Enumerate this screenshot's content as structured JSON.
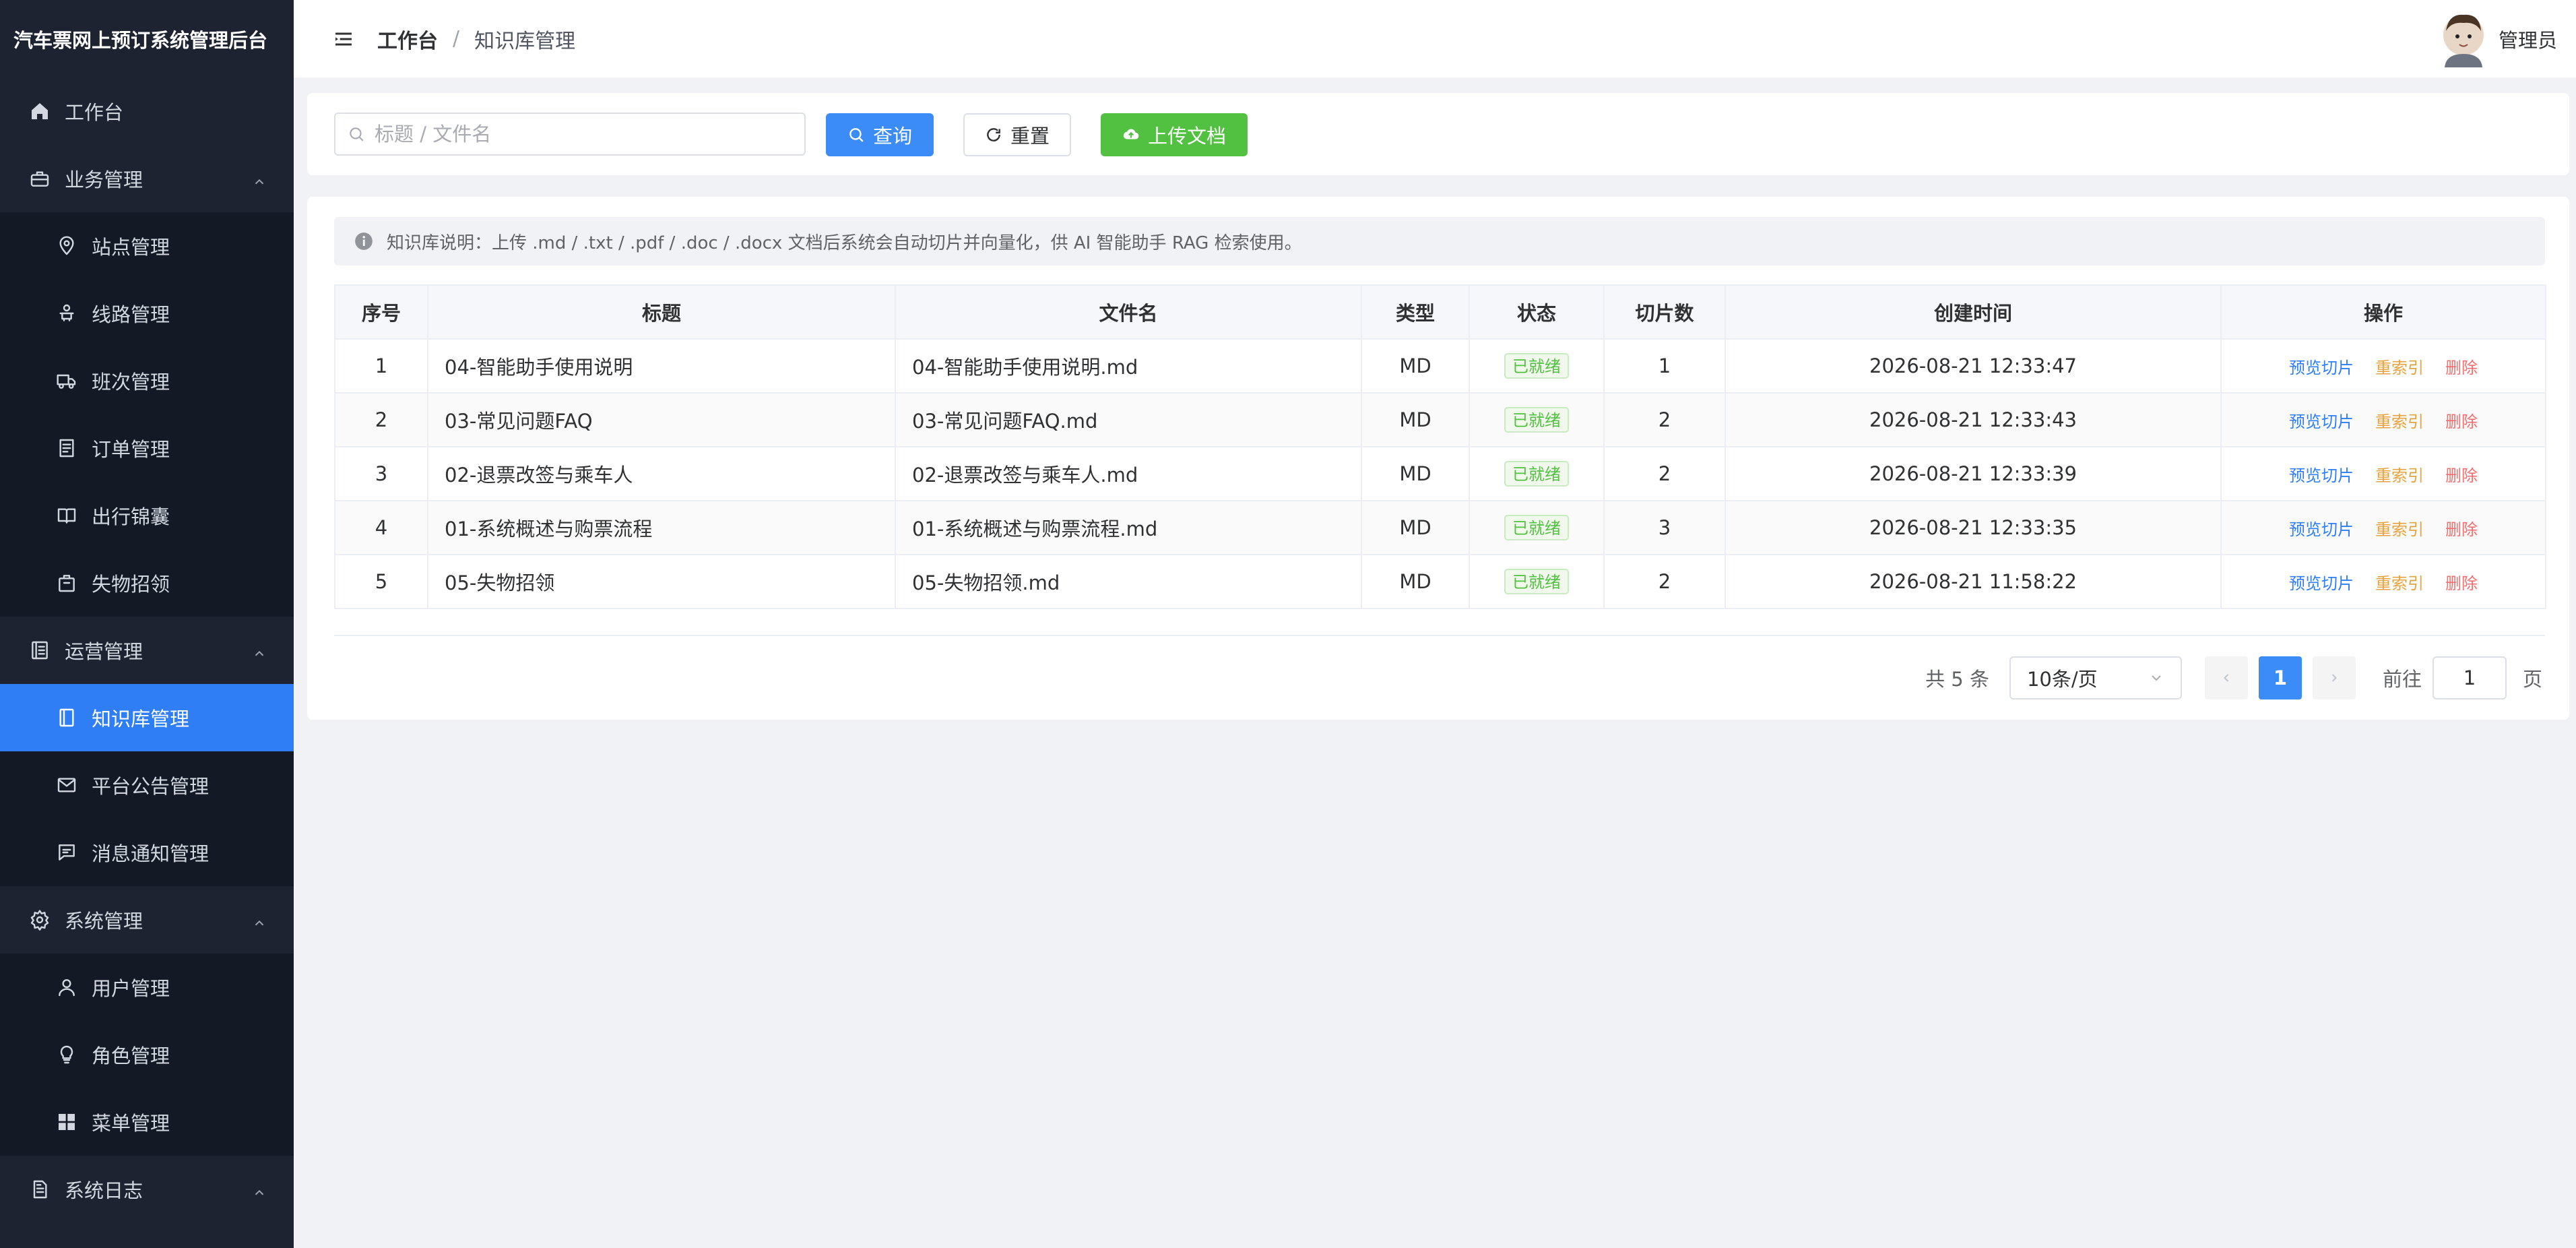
{
  "app": {
    "title": "汽车票网上预订系统管理后台"
  },
  "colors": {
    "sidebar_bg": "#1d2330",
    "active": "#2f7ef5",
    "primary": "#3c8cf7",
    "success": "#52c041",
    "warning": "#e6a23c",
    "danger": "#f56c6c"
  },
  "sidebar": {
    "items": [
      {
        "label": "工作台",
        "icon": "home-icon",
        "level": "top"
      },
      {
        "label": "业务管理",
        "icon": "briefcase-icon",
        "level": "top",
        "expanded": true
      },
      {
        "label": "站点管理",
        "icon": "location-icon",
        "level": "sub"
      },
      {
        "label": "线路管理",
        "icon": "route-icon",
        "level": "sub"
      },
      {
        "label": "班次管理",
        "icon": "truck-icon",
        "level": "sub"
      },
      {
        "label": "订单管理",
        "icon": "document-icon",
        "level": "sub"
      },
      {
        "label": "出行锦囊",
        "icon": "book-icon",
        "level": "sub"
      },
      {
        "label": "失物招领",
        "icon": "bag-icon",
        "level": "sub"
      },
      {
        "label": "运营管理",
        "icon": "list-icon",
        "level": "top",
        "expanded": true
      },
      {
        "label": "知识库管理",
        "icon": "notebook-icon",
        "level": "sub",
        "active": true
      },
      {
        "label": "平台公告管理",
        "icon": "mail-icon",
        "level": "sub"
      },
      {
        "label": "消息通知管理",
        "icon": "chat-icon",
        "level": "sub"
      },
      {
        "label": "系统管理",
        "icon": "gear-icon",
        "level": "top",
        "expanded": true
      },
      {
        "label": "用户管理",
        "icon": "user-icon",
        "level": "sub"
      },
      {
        "label": "角色管理",
        "icon": "bulb-icon",
        "level": "sub"
      },
      {
        "label": "菜单管理",
        "icon": "grid-icon",
        "level": "sub"
      },
      {
        "label": "系统日志",
        "icon": "log-icon",
        "level": "top",
        "expanded": true
      }
    ]
  },
  "header": {
    "breadcrumb_home": "工作台",
    "breadcrumb_sep": "/",
    "breadcrumb_current": "知识库管理",
    "user_name": "管理员"
  },
  "search": {
    "placeholder": "标题 / 文件名",
    "value": "",
    "query_label": "查询",
    "reset_label": "重置",
    "upload_label": "上传文档"
  },
  "notice": {
    "text": "知识库说明：上传 .md / .txt / .pdf / .doc / .docx 文档后系统会自动切片并向量化，供 AI 智能助手 RAG 检索使用。"
  },
  "table": {
    "columns": [
      "序号",
      "标题",
      "文件名",
      "类型",
      "状态",
      "切片数",
      "创建时间",
      "操作"
    ],
    "rows": [
      {
        "index": "1",
        "title": "04-智能助手使用说明",
        "file": "04-智能助手使用说明.md",
        "type": "MD",
        "status": "已就绪",
        "chunks": "1",
        "created": "2026-08-21 12:33:47"
      },
      {
        "index": "2",
        "title": "03-常见问题FAQ",
        "file": "03-常见问题FAQ.md",
        "type": "MD",
        "status": "已就绪",
        "chunks": "2",
        "created": "2026-08-21 12:33:43"
      },
      {
        "index": "3",
        "title": "02-退票改签与乘车人",
        "file": "02-退票改签与乘车人.md",
        "type": "MD",
        "status": "已就绪",
        "chunks": "2",
        "created": "2026-08-21 12:33:39"
      },
      {
        "index": "4",
        "title": "01-系统概述与购票流程",
        "file": "01-系统概述与购票流程.md",
        "type": "MD",
        "status": "已就绪",
        "chunks": "3",
        "created": "2026-08-21 12:33:35"
      },
      {
        "index": "5",
        "title": "05-失物招领",
        "file": "05-失物招领.md",
        "type": "MD",
        "status": "已就绪",
        "chunks": "2",
        "created": "2026-08-21 11:58:22"
      }
    ],
    "actions": {
      "preview": "预览切片",
      "reindex": "重索引",
      "delete": "删除"
    }
  },
  "pagination": {
    "total_text": "共 5 条",
    "page_size": "10条/页",
    "current_page": "1",
    "goto_label": "前往",
    "goto_value": "1",
    "page_suffix": "页"
  }
}
